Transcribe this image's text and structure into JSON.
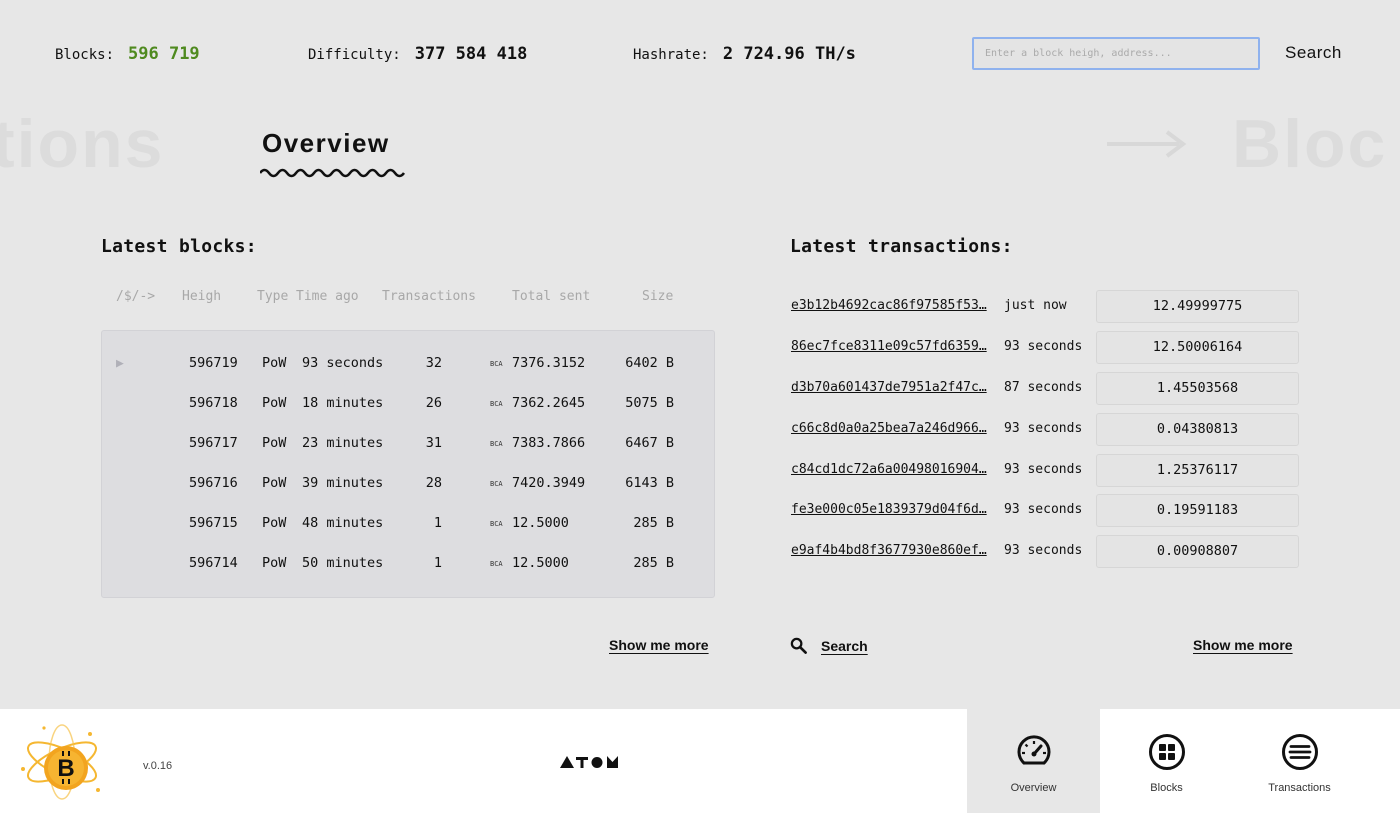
{
  "stats": {
    "blocks_label": "Blocks:",
    "blocks_value": "596 719",
    "difficulty_label": "Difficulty:",
    "difficulty_value": "377 584 418",
    "hashrate_label": "Hashrate:",
    "hashrate_value": "2 724.96 TH/s"
  },
  "search": {
    "placeholder": "Enter a block heigh, address...",
    "button_label": "Search"
  },
  "nav_ghost": {
    "left": "tions",
    "right": "Bloc"
  },
  "page": {
    "title": "Overview"
  },
  "blocks": {
    "title": "Latest blocks:",
    "columns": {
      "marker": "/$/->",
      "height": "Heigh",
      "type": "Type",
      "time": "Time ago",
      "transactions": "Transactions",
      "total": "Total sent",
      "size": "Size"
    },
    "currency": "BCA",
    "rows": [
      {
        "height": "596719",
        "type": "PoW",
        "time": "93 seconds",
        "tx": "32",
        "total": "7376.3152",
        "size": "6402 B"
      },
      {
        "height": "596718",
        "type": "PoW",
        "time": "18 minutes",
        "tx": "26",
        "total": "7362.2645",
        "size": "5075 B"
      },
      {
        "height": "596717",
        "type": "PoW",
        "time": "23 minutes",
        "tx": "31",
        "total": "7383.7866",
        "size": "6467 B"
      },
      {
        "height": "596716",
        "type": "PoW",
        "time": "39 minutes",
        "tx": "28",
        "total": "7420.3949",
        "size": "6143 B"
      },
      {
        "height": "596715",
        "type": "PoW",
        "time": "48 minutes",
        "tx": "1",
        "total": "12.5000",
        "size": "285 B"
      },
      {
        "height": "596714",
        "type": "PoW",
        "time": "50 minutes",
        "tx": "1",
        "total": "12.5000",
        "size": "285 B"
      }
    ],
    "more_label": "Show me more"
  },
  "transactions": {
    "title": "Latest transactions:",
    "rows": [
      {
        "hash": "e3b12b4692cac86f97585f53…",
        "time": "just now",
        "amount": "12.49999775"
      },
      {
        "hash": "86ec7fce8311e09c57fd6359…",
        "time": "93 seconds",
        "amount": "12.50006164"
      },
      {
        "hash": "d3b70a601437de7951a2f47c…",
        "time": "87 seconds",
        "amount": "1.45503568"
      },
      {
        "hash": "c66c8d0a0a25bea7a246d966…",
        "time": "93 seconds",
        "amount": "0.04380813"
      },
      {
        "hash": "c84cd1dc72a6a00498016904…",
        "time": "93 seconds",
        "amount": "1.25376117"
      },
      {
        "hash": "fe3e000c05e1839379d04f6d…",
        "time": "93 seconds",
        "amount": "0.19591183"
      },
      {
        "hash": "e9af4b4bd8f3677930e860ef…",
        "time": "93 seconds",
        "amount": "0.00908807"
      }
    ],
    "search_label": "Search",
    "more_label": "Show me more"
  },
  "footer": {
    "version": "v.0.16",
    "nav": [
      {
        "label": "Overview",
        "icon": "speedometer-icon",
        "active": true
      },
      {
        "label": "Blocks",
        "icon": "grid-icon",
        "active": false
      },
      {
        "label": "Transactions",
        "icon": "list-lines-icon",
        "active": false
      }
    ]
  },
  "colors": {
    "background": "#e7e7e7",
    "accent_green": "#4f8a1f",
    "search_border": "#8fb2ee",
    "table_bg": "#dddde0",
    "footer_bg": "#ffffff"
  }
}
